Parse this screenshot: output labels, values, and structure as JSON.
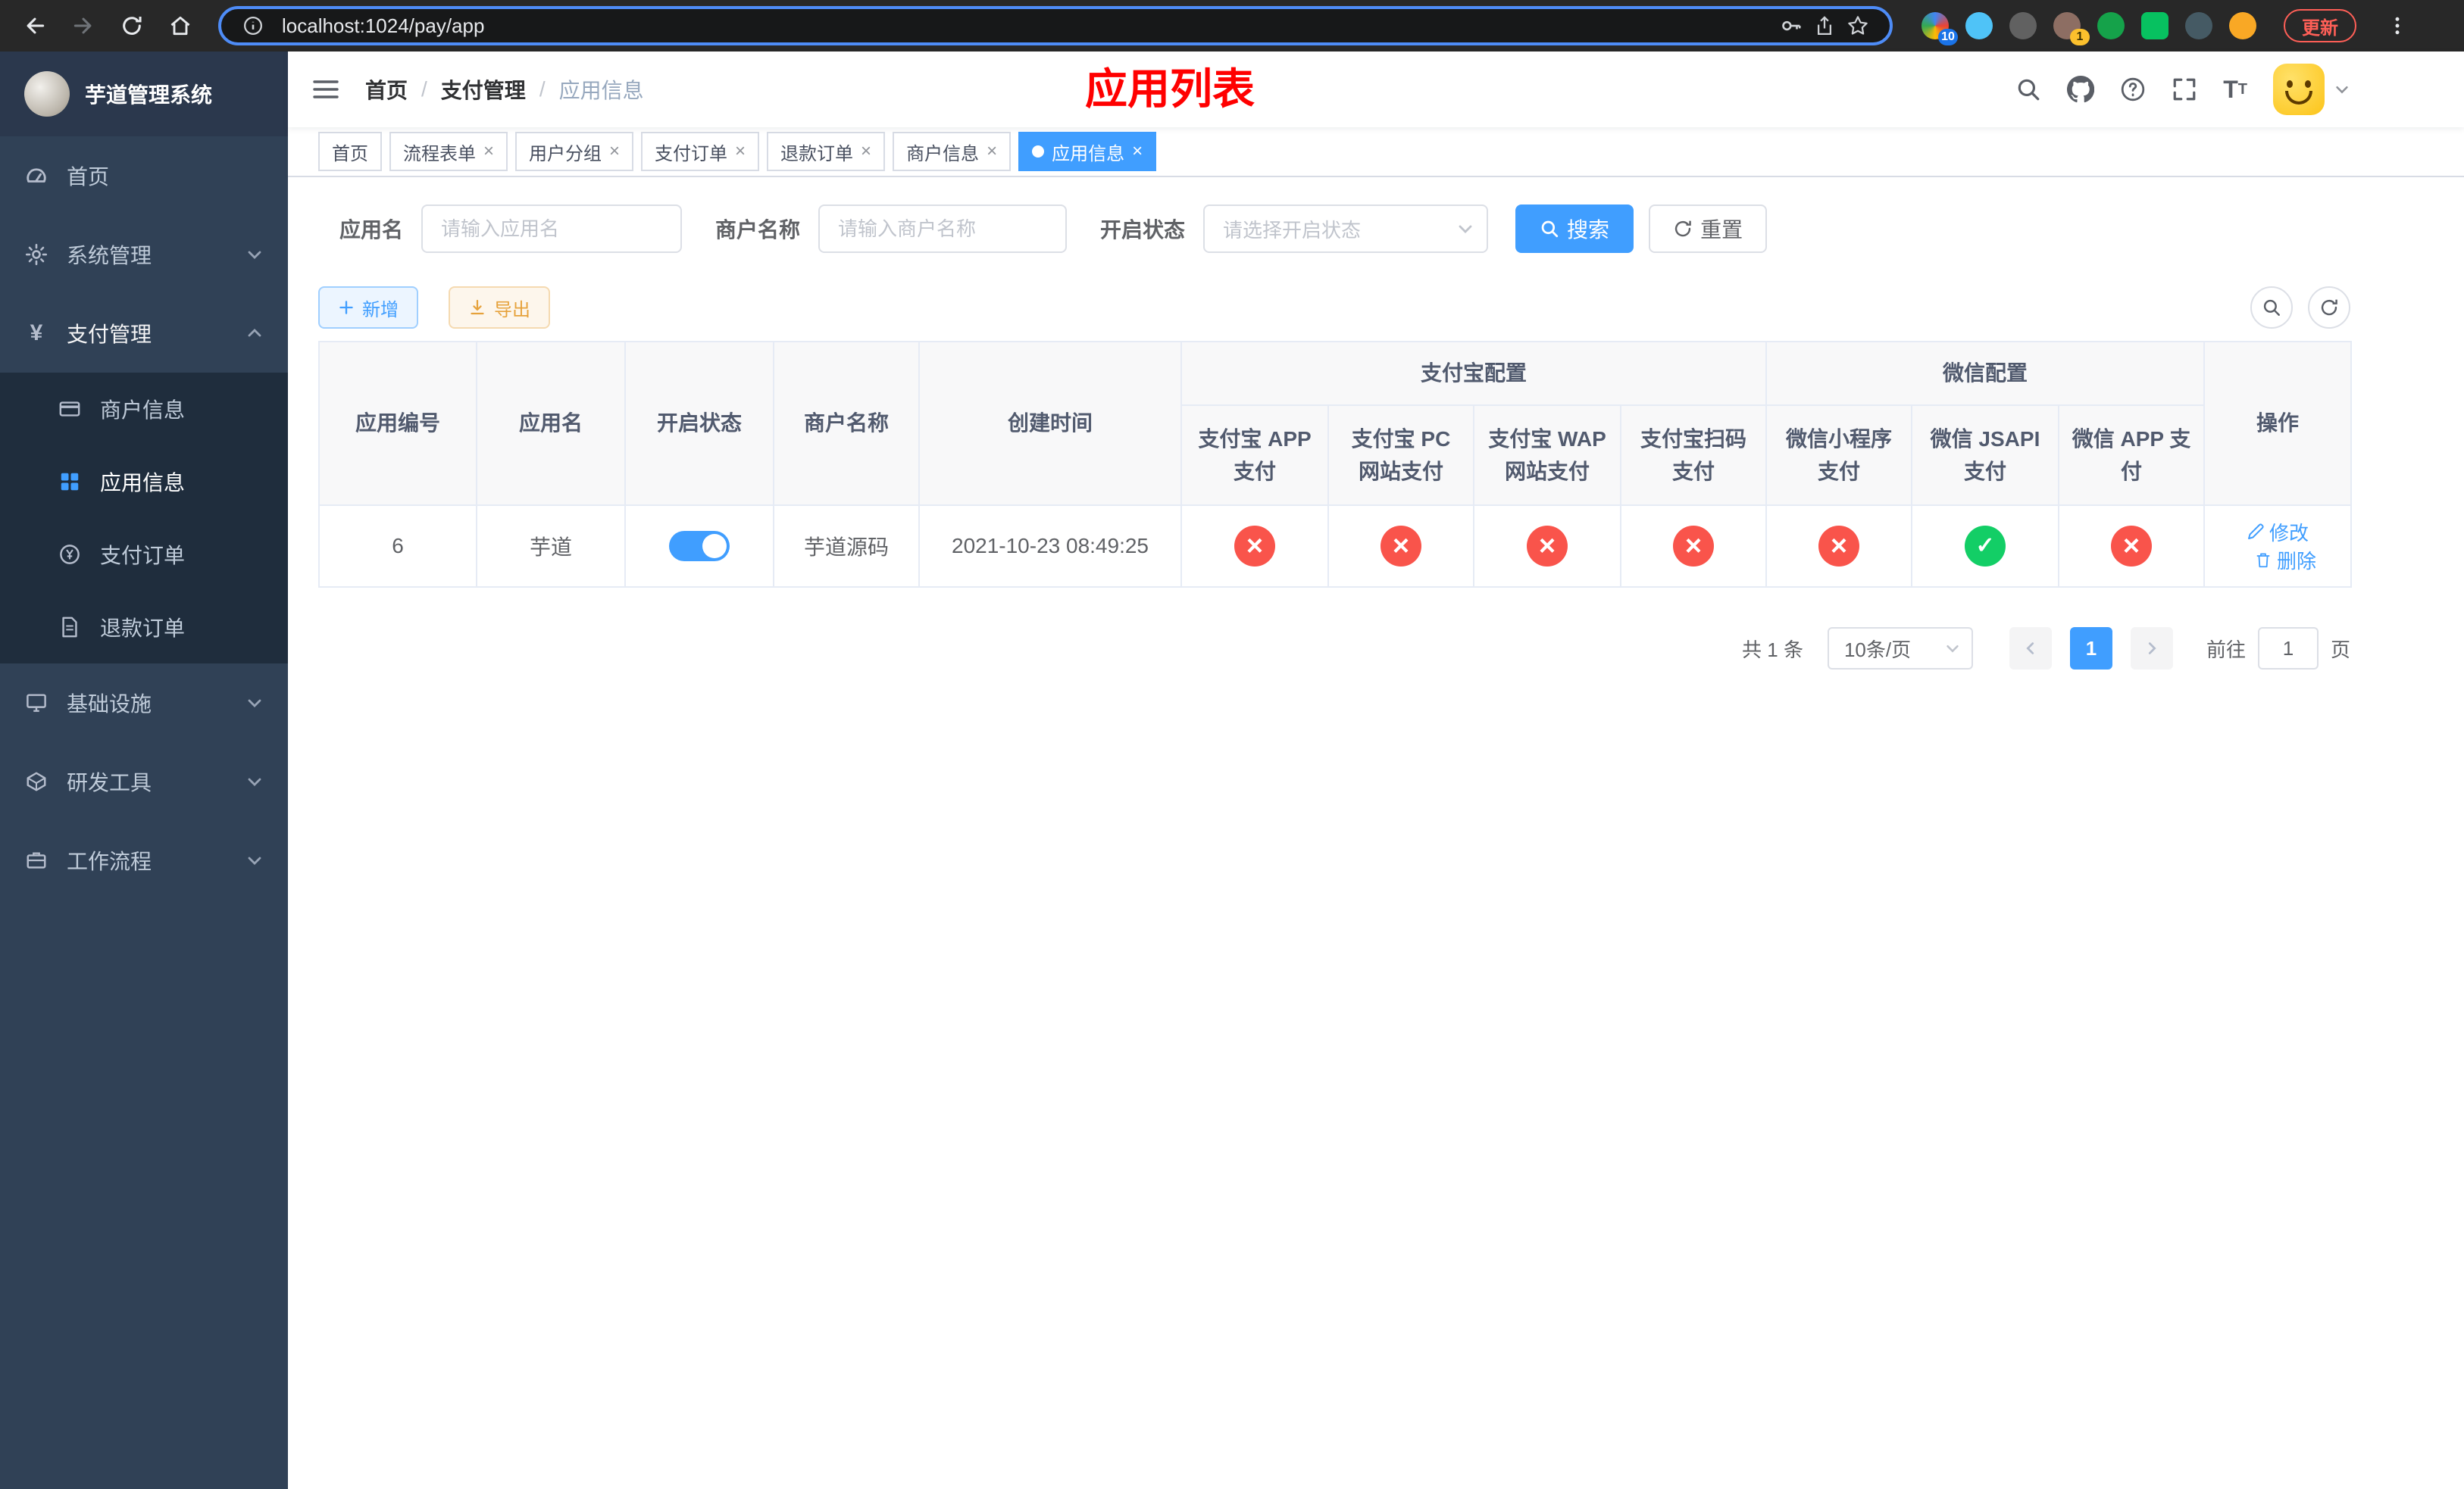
{
  "colors": {
    "primary": "#409eff",
    "success": "#13ce66",
    "danger": "#f9544b",
    "warning": "#e6a23c",
    "sidebar_bg": "#304156",
    "sidebar_submenu_bg": "#1f2d3d",
    "title_red": "#ff0000"
  },
  "browser": {
    "url": "localhost:1024/pay/app",
    "update_label": "更新",
    "extension_badge_first": "10",
    "extension_badge_profile": "1"
  },
  "sidebar": {
    "brand": "芋道管理系统",
    "items": [
      {
        "label": "首页"
      },
      {
        "label": "系统管理"
      },
      {
        "label": "支付管理"
      },
      {
        "label": "商户信息"
      },
      {
        "label": "应用信息"
      },
      {
        "label": "支付订单"
      },
      {
        "label": "退款订单"
      },
      {
        "label": "基础设施"
      },
      {
        "label": "研发工具"
      },
      {
        "label": "工作流程"
      }
    ]
  },
  "header": {
    "breadcrumb": {
      "home": "首页",
      "section": "支付管理",
      "current": "应用信息"
    },
    "title": "应用列表"
  },
  "tabs": [
    {
      "label": "首页"
    },
    {
      "label": "流程表单"
    },
    {
      "label": "用户分组"
    },
    {
      "label": "支付订单"
    },
    {
      "label": "退款订单"
    },
    {
      "label": "商户信息"
    },
    {
      "label": "应用信息"
    }
  ],
  "filters": {
    "app_name_label": "应用名",
    "app_name_placeholder": "请输入应用名",
    "merchant_label": "商户名称",
    "merchant_placeholder": "请输入商户名称",
    "status_label": "开启状态",
    "status_placeholder": "请选择开启状态",
    "search": "搜索",
    "reset": "重置"
  },
  "toolbar": {
    "add": "新增",
    "export": "导出"
  },
  "table": {
    "groups": {
      "alipay": "支付宝配置",
      "wechat": "微信配置"
    },
    "columns": {
      "id": "应用编号",
      "name": "应用名",
      "status": "开启状态",
      "merchant": "商户名称",
      "created": "创建时间",
      "alipay_app": "支付宝 APP 支付",
      "alipay_pc": "支付宝 PC 网站支付",
      "alipay_wap": "支付宝 WAP 网站支付",
      "alipay_scan": "支付宝扫码支付",
      "wx_lite": "微信小程序支付",
      "wx_jsapi": "微信 JSAPI 支付",
      "wx_app": "微信 APP 支付",
      "actions": "操作"
    },
    "rows": [
      {
        "id": "6",
        "name": "芋道",
        "status_on": true,
        "merchant": "芋道源码",
        "created": "2021-10-23 08:49:25",
        "configs": [
          false,
          false,
          false,
          false,
          false,
          true,
          false
        ],
        "edit": "修改",
        "delete": "删除"
      }
    ]
  },
  "pagination": {
    "total": "共 1 条",
    "page_size": "10条/页",
    "page": "1",
    "goto": "前往",
    "goto_value": "1",
    "unit": "页"
  }
}
